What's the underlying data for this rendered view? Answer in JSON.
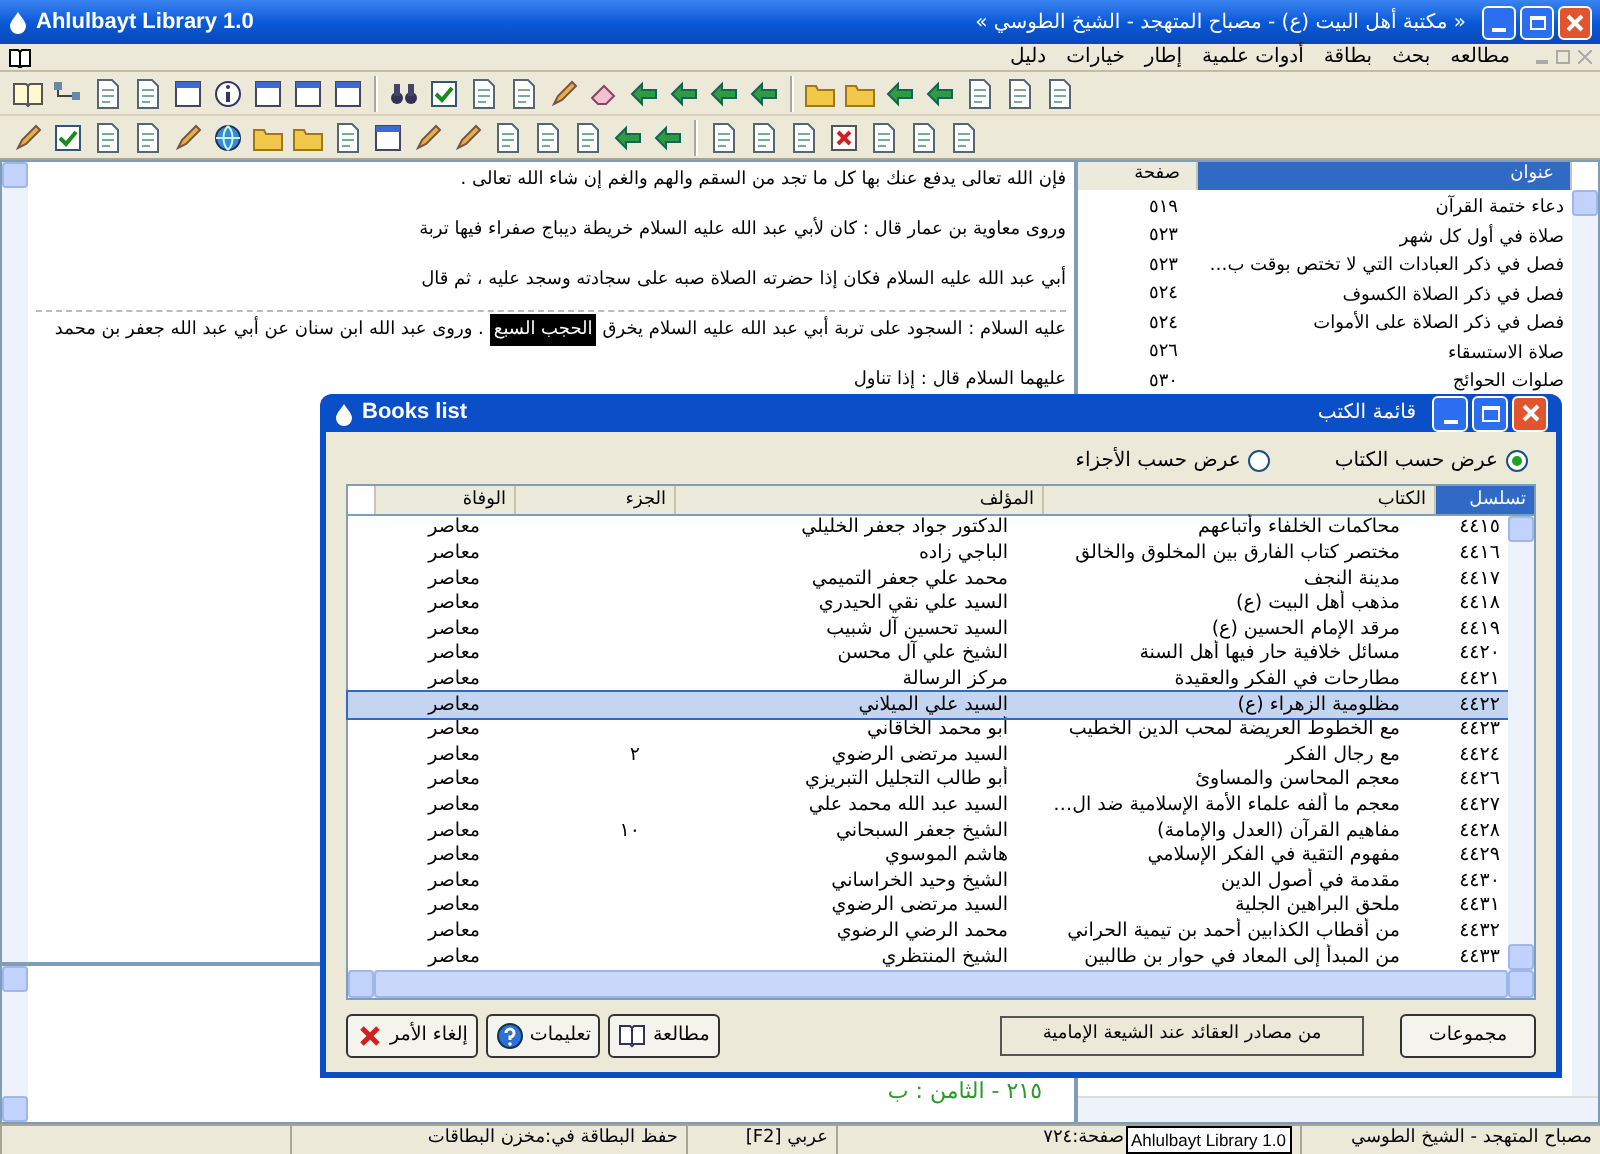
{
  "window": {
    "app_name": "Ahlulbayt Library 1.0",
    "title": "« مكتبة أهل البيت (ع) - مصباح المتهجد - الشيخ الطوسي »"
  },
  "menu": [
    "مطالعه",
    "بحث",
    "بطاقة",
    "أدوات علمية",
    "إطار",
    "خيارات",
    "دليل"
  ],
  "reader": {
    "lines": [
      {
        "page_break_after": false,
        "segments": [
          {
            "text": "فإن الله تعالى يدفع عنك بها كل ما تجد من السقم والهم والغم إن شاء الله تعالى .",
            "highlighted": false
          }
        ]
      },
      {
        "page_break_after": false,
        "segments": [
          {
            "text": "وروى معاوية بن عمار قال : كان لأبي عبد الله عليه السلام خريطة ديباج صفراء فيها تربة",
            "highlighted": false
          }
        ]
      },
      {
        "page_break_after": true,
        "segments": [
          {
            "text": "أبي عبد الله عليه السلام فكان إذا حضرته الصلاة صبه على سجادته وسجد عليه ، ثم قال",
            "highlighted": false
          }
        ]
      },
      {
        "page_break_after": false,
        "segments": [
          {
            "text": "عليه السلام : السجود على تربة أبي عبد الله عليه السلام يخرق",
            "highlighted": false
          },
          {
            "text": "الحجب السبع",
            "highlighted": true
          },
          {
            "text": ". وروى عبد الله ابن سنان عن أبي عبد الله جعفر بن محمد",
            "highlighted": false
          }
        ]
      },
      {
        "page_break_after": false,
        "segments": [
          {
            "text": "عليهما السلام قال : إذا تناول",
            "highlighted": false
          }
        ]
      }
    ]
  },
  "notes_pane": {
    "lines": [
      "٢١٥ - الثامن : ب"
    ]
  },
  "contents": {
    "columns": [
      {
        "label": "عنوان",
        "selected": true
      },
      {
        "label": "صفحة",
        "selected": false
      }
    ],
    "rows": [
      {
        "title": "دعاء ختمة القرآن",
        "page": "٥١٩"
      },
      {
        "title": "صلاة في أول كل شهر",
        "page": "٥٢٣"
      },
      {
        "title": "فصل في ذكر العبادات التي لا تختص بوقت ب…",
        "page": "٥٢٣"
      },
      {
        "title": "فصل في ذكر الصلاة الكسوف",
        "page": "٥٢٤"
      },
      {
        "title": "فصل في ذكر الصلاة على الأموات",
        "page": "٥٢٤"
      },
      {
        "title": "صلاة الاستسقاء",
        "page": "٥٢٦"
      },
      {
        "title": "صلوات الحوائج",
        "page": "٥٣٠"
      }
    ]
  },
  "dialog": {
    "title": "Books list",
    "title_arabic": "قائمة الكتب",
    "view_options": [
      {
        "label": "عرض حسب الكتاب",
        "selected": true
      },
      {
        "label": "عرض حسب الأجزاء",
        "selected": false
      }
    ],
    "columns": [
      {
        "label": "تسلسل",
        "selected": true
      },
      {
        "label": "الكتاب",
        "selected": false
      },
      {
        "label": "المؤلف",
        "selected": false
      },
      {
        "label": "الجزء",
        "selected": false
      },
      {
        "label": "الوفاة",
        "selected": false
      }
    ],
    "rows": [
      {
        "number": "٤٤١٥",
        "book": "محاكمات الخلفاء وأتباعهم",
        "author": "الدكتور جواد جعفر الخليلي",
        "volume": "",
        "death": "معاصر",
        "selected": false
      },
      {
        "number": "٤٤١٦",
        "book": "مختصر كتاب الفارق بين المخلوق والخالق",
        "author": "الباجي زاده",
        "volume": "",
        "death": "معاصر",
        "selected": false
      },
      {
        "number": "٤٤١٧",
        "book": "مدينة النجف",
        "author": "محمد علي جعفر التميمي",
        "volume": "",
        "death": "معاصر",
        "selected": false
      },
      {
        "number": "٤٤١٨",
        "book": "مذهب أهل البيت (ع)",
        "author": "السيد علي نقي الحيدري",
        "volume": "",
        "death": "معاصر",
        "selected": false
      },
      {
        "number": "٤٤١٩",
        "book": "مرقد الإمام الحسين (ع)",
        "author": "السيد تحسين آل شبيب",
        "volume": "",
        "death": "معاصر",
        "selected": false
      },
      {
        "number": "٤٤٢٠",
        "book": "مسائل خلافية حار فيها أهل السنة",
        "author": "الشيخ علي آل محسن",
        "volume": "",
        "death": "معاصر",
        "selected": false
      },
      {
        "number": "٤٤٢١",
        "book": "مطارحات في الفكر والعقيدة",
        "author": "مركز الرسالة",
        "volume": "",
        "death": "معاصر",
        "selected": false
      },
      {
        "number": "٤٤٢٢",
        "book": "مظلومية الزهراء (ع)",
        "author": "السيد علي الميلاني",
        "volume": "",
        "death": "معاصر",
        "selected": true
      },
      {
        "number": "٤٤٢٣",
        "book": "مع الخطوط العريضة لمحب الدين الخطيب",
        "author": "أبو محمد الخاقاني",
        "volume": "",
        "death": "معاصر",
        "selected": false
      },
      {
        "number": "٤٤٢٤",
        "book": "مع رجال الفكر",
        "author": "السيد مرتضى الرضوي",
        "volume": "٢",
        "death": "معاصر",
        "selected": false
      },
      {
        "number": "٤٤٢٦",
        "book": "معجم المحاسن والمساوئ",
        "author": "أبو طالب التجليل التبريزي",
        "volume": "",
        "death": "معاصر",
        "selected": false
      },
      {
        "number": "٤٤٢٧",
        "book": "معجم ما ألفه علماء الأمة الإسلامية ضد ال…",
        "author": "السيد عبد الله محمد علي",
        "volume": "",
        "death": "معاصر",
        "selected": false
      },
      {
        "number": "٤٤٢٨",
        "book": "مفاهيم القرآن (العدل والإمامة)",
        "author": "الشيخ جعفر السبحاني",
        "volume": "١٠",
        "death": "معاصر",
        "selected": false
      },
      {
        "number": "٤٤٢٩",
        "book": "مفهوم التقية في الفكر الإسلامي",
        "author": "هاشم الموسوي",
        "volume": "",
        "death": "معاصر",
        "selected": false
      },
      {
        "number": "٤٤٣٠",
        "book": "مقدمة في أصول الدين",
        "author": "الشيخ وحيد الخراساني",
        "volume": "",
        "death": "معاصر",
        "selected": false
      },
      {
        "number": "٤٤٣١",
        "book": "ملحق البراهين الجلية",
        "author": "السيد مرتضى الرضوي",
        "volume": "",
        "death": "معاصر",
        "selected": false
      },
      {
        "number": "٤٤٣٢",
        "book": "من أقطاب الكذابين أحمد بن تيمية الحراني",
        "author": "محمد الرضي الرضوي",
        "volume": "",
        "death": "معاصر",
        "selected": false
      },
      {
        "number": "٤٤٣٣",
        "book": "من المبدأ إلى المعاد في حوار بن طالبين",
        "author": "الشيخ المنتظري",
        "volume": "",
        "death": "معاصر",
        "selected": false
      }
    ],
    "footer": [
      {
        "kind": "button",
        "label": "مجموعات"
      },
      {
        "kind": "field",
        "value": "من مصادر العقائد عند الشيعة الإمامية"
      },
      {
        "kind": "read",
        "label": "مطالعة"
      },
      {
        "kind": "help",
        "label": "تعليمات"
      },
      {
        "kind": "cancel",
        "label": "إلغاء الأمر"
      }
    ]
  },
  "status_bar": [
    {
      "text": "مصباح المتهجد - الشيخ الطوسي",
      "boxed": false
    },
    {
      "text": "Ahlulbayt Library 1.0",
      "boxed": true
    },
    {
      "text": "صفحة:٧٢٤",
      "boxed": false
    },
    {
      "text": "عربي [F2]",
      "boxed": false
    },
    {
      "text": "حفظ البطاقة في:مخزن البطاقات",
      "boxed": false
    }
  ]
}
